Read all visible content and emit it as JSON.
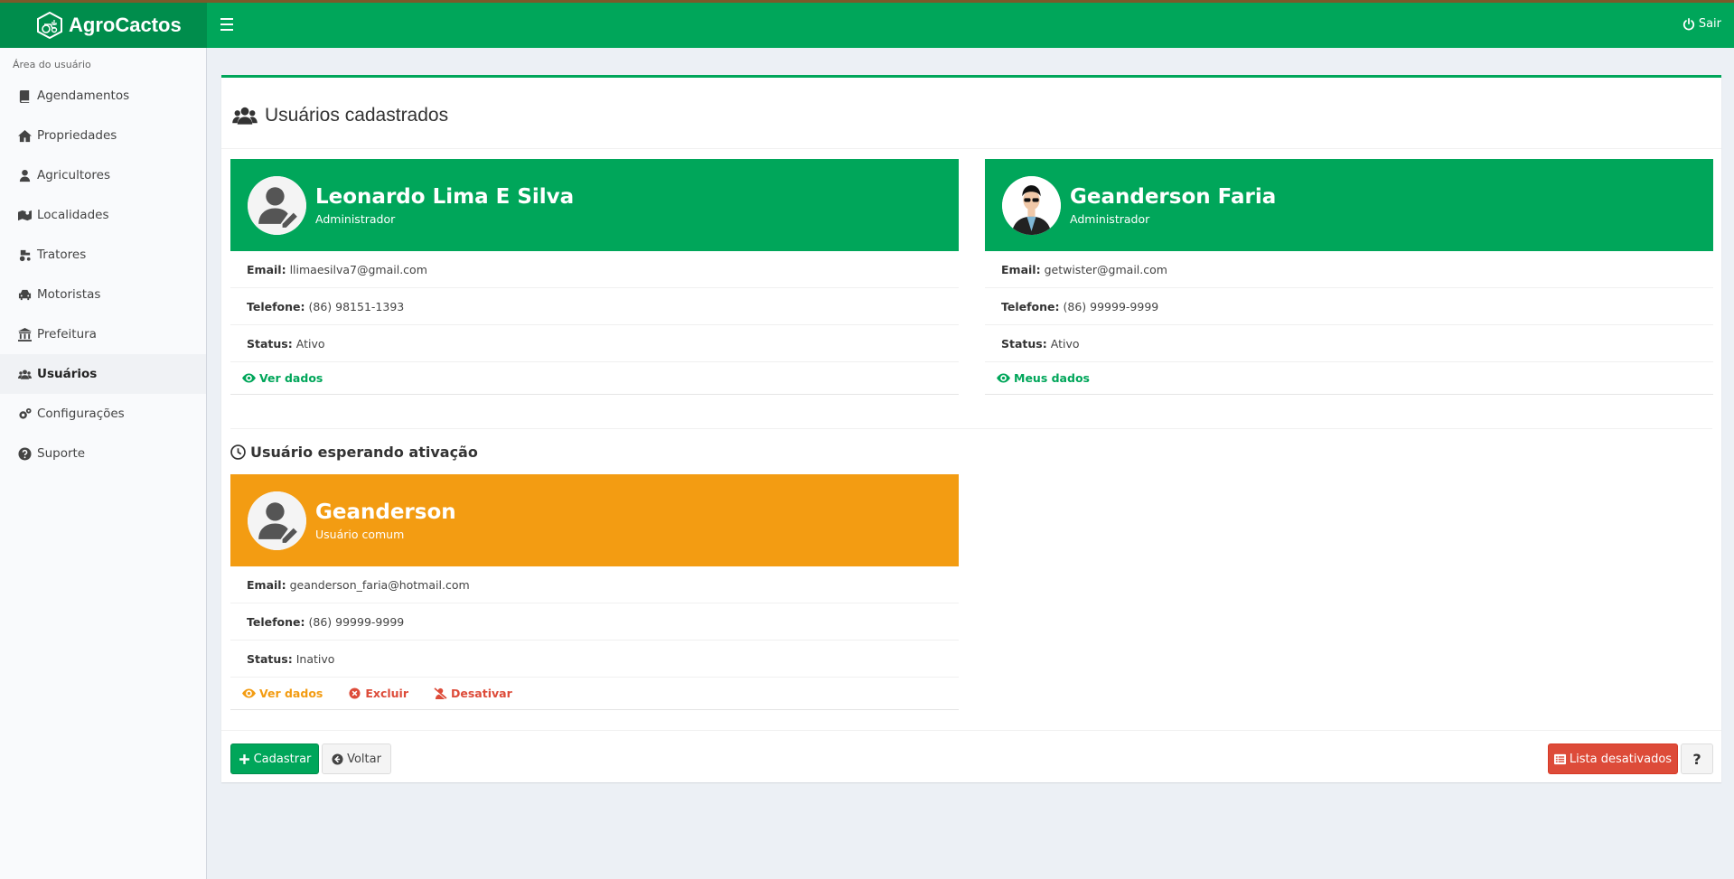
{
  "app": {
    "name": "AgroCactos",
    "logout_label": "Sair"
  },
  "sidebar": {
    "header": "Área do usuário",
    "items": [
      {
        "label": "Agendamentos",
        "icon": "book-icon"
      },
      {
        "label": "Propriedades",
        "icon": "home-icon"
      },
      {
        "label": "Agricultores",
        "icon": "user-icon"
      },
      {
        "label": "Localidades",
        "icon": "map-icon"
      },
      {
        "label": "Tratores",
        "icon": "tractor-icon"
      },
      {
        "label": "Motoristas",
        "icon": "car-icon"
      },
      {
        "label": "Prefeitura",
        "icon": "bank-icon"
      },
      {
        "label": "Usuários",
        "icon": "users-icon",
        "active": true
      },
      {
        "label": "Configurações",
        "icon": "cogs-icon"
      },
      {
        "label": "Suporte",
        "icon": "question-circle-icon"
      }
    ]
  },
  "page": {
    "title": "Usuários cadastrados",
    "waiting_title": "Usuário esperando ativação"
  },
  "labels": {
    "email": "Email:",
    "phone": "Telefone:",
    "status": "Status:"
  },
  "users": [
    {
      "name": "Leonardo Lima E Silva",
      "role": "Administrador",
      "email": "llimaesilva7@gmail.com",
      "phone": "(86) 98151-1393",
      "status": "Ativo",
      "action": "Ver dados"
    },
    {
      "name": "Geanderson Faria",
      "role": "Administrador",
      "email": "getwister@gmail.com",
      "phone": "(86) 99999-9999",
      "status": "Ativo",
      "action": "Meus dados"
    }
  ],
  "pending": {
    "name": "Geanderson",
    "role": "Usuário comum",
    "email": "geanderson_faria@hotmail.com",
    "phone": "(86) 99999-9999",
    "status": "Inativo",
    "actions": {
      "view": "Ver dados",
      "delete": "Excluir",
      "deactivate": "Desativar"
    }
  },
  "footer": {
    "register": "Cadastrar",
    "back": "Voltar",
    "deactivated_list": "Lista desativados",
    "help": "?"
  },
  "colors": {
    "primary": "#00a65a",
    "warning": "#f39c12",
    "danger": "#dd4b39"
  }
}
